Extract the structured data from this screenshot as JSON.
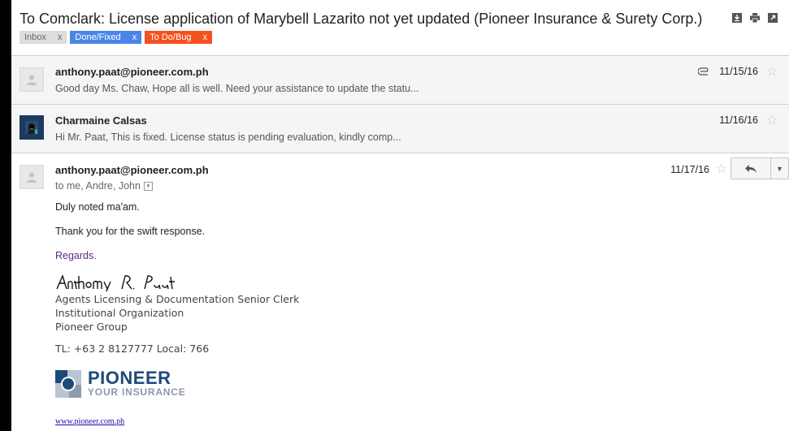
{
  "subject": "To Comclark: License application of Marybell Lazarito not yet updated (Pioneer Insurance & Surety Corp.)",
  "labels": [
    {
      "text": "Inbox",
      "x": "x",
      "bg": "#dddddd",
      "fg": "#666666"
    },
    {
      "text": "Done/Fixed",
      "x": "x",
      "bg": "#4a86e8",
      "fg": "#ffffff"
    },
    {
      "text": "To Do/Bug",
      "x": "x",
      "bg": "#f4511e",
      "fg": "#ffffff"
    }
  ],
  "toolbar_icons": [
    "download-icon",
    "print-icon",
    "open-in-new-window-icon"
  ],
  "messages": [
    {
      "sender": "anthony.paat@pioneer.com.ph",
      "snippet": "Good day Ms. Chaw, Hope all is well. Need your assistance to update the statu...",
      "date": "11/15/16",
      "has_attachment": true
    },
    {
      "sender": "Charmaine Calsas",
      "snippet": "Hi Mr. Paat, This is fixed. License status is pending evaluation, kindly comp...",
      "date": "11/16/16",
      "has_attachment": false
    }
  ],
  "expanded": {
    "sender": "anthony.paat@pioneer.com.ph",
    "to": "to me, Andre, John",
    "date": "11/17/16",
    "body": [
      "Duly noted ma'am.",
      "Thank you for the swift response.",
      "Regards."
    ],
    "signature_name": "Anthony R. Paat",
    "signature_lines": [
      "Agents Licensing & Documentation Senior Clerk",
      "Institutional Organization",
      "Pioneer Group"
    ],
    "phone": "TL: +63  2 8127777  Local: 766",
    "logo_main": "PIONEER",
    "logo_sub": "YOUR INSURANCE",
    "link": "www.pioneer.com.ph"
  }
}
